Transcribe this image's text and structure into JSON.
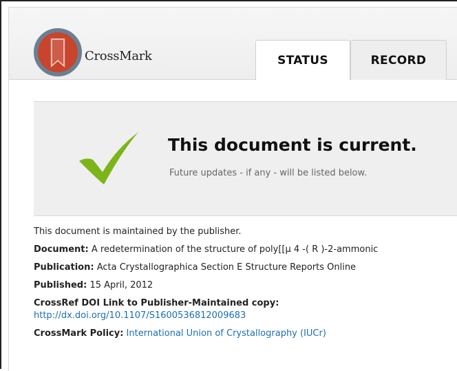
{
  "brand": {
    "name": "CrossMark"
  },
  "tabs": [
    {
      "label": "STATUS",
      "active": true
    },
    {
      "label": "RECORD",
      "active": false
    }
  ],
  "status": {
    "title": "This document is current.",
    "subtitle": "Future updates - if any - will be listed below.",
    "icon": "checkmark-icon",
    "icon_color": "#7cb518"
  },
  "info": {
    "maintained": "This document is maintained by the publisher.",
    "document_label": "Document:",
    "document_value": "A redetermination of the structure of poly[[μ 4 -( R )-2-ammonic",
    "publication_label": "Publication:",
    "publication_value": "Acta Crystallographica Section E Structure Reports Online",
    "published_label": "Published:",
    "published_value": "15 April, 2012",
    "doi_label": "CrossRef DOI Link to Publisher-Maintained copy:",
    "doi_value": "http://dx.doi.org/10.1107/S1600536812009683",
    "policy_label": "CrossMark Policy:",
    "policy_value": "International Union of Crystallography (IUCr)"
  },
  "colors": {
    "link": "#1a6fb5",
    "logo_red": "#c8442c",
    "logo_ring": "#6b7f93"
  }
}
